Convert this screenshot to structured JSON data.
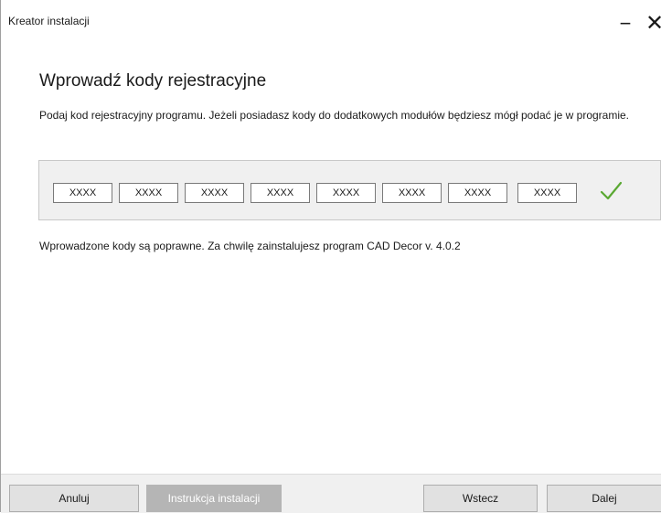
{
  "window": {
    "title": "Kreator instalacji",
    "minimize_glyph": "−",
    "close_glyph": "✕"
  },
  "content": {
    "heading": "Wprowadź kody rejestracyjne",
    "description": "Podaj kod rejestracyjny programu. Jeżeli posiadasz kody do dodatkowych modułów będziesz mógł podać je w programie.",
    "codes": [
      "XXXX",
      "XXXX",
      "XXXX",
      "XXXX",
      "XXXX",
      "XXXX",
      "XXXX",
      "XXXX"
    ],
    "valid_icon": "checkmark-icon",
    "valid_color": "#5aa832",
    "status": "Wprowadzone kody są poprawne. Za chwilę zainstalujesz program CAD Decor v. 4.0.2"
  },
  "footer": {
    "cancel_label": "Anuluj",
    "manual_label": "Instrukcja instalacji",
    "back_label": "Wstecz",
    "next_label": "Dalej"
  }
}
